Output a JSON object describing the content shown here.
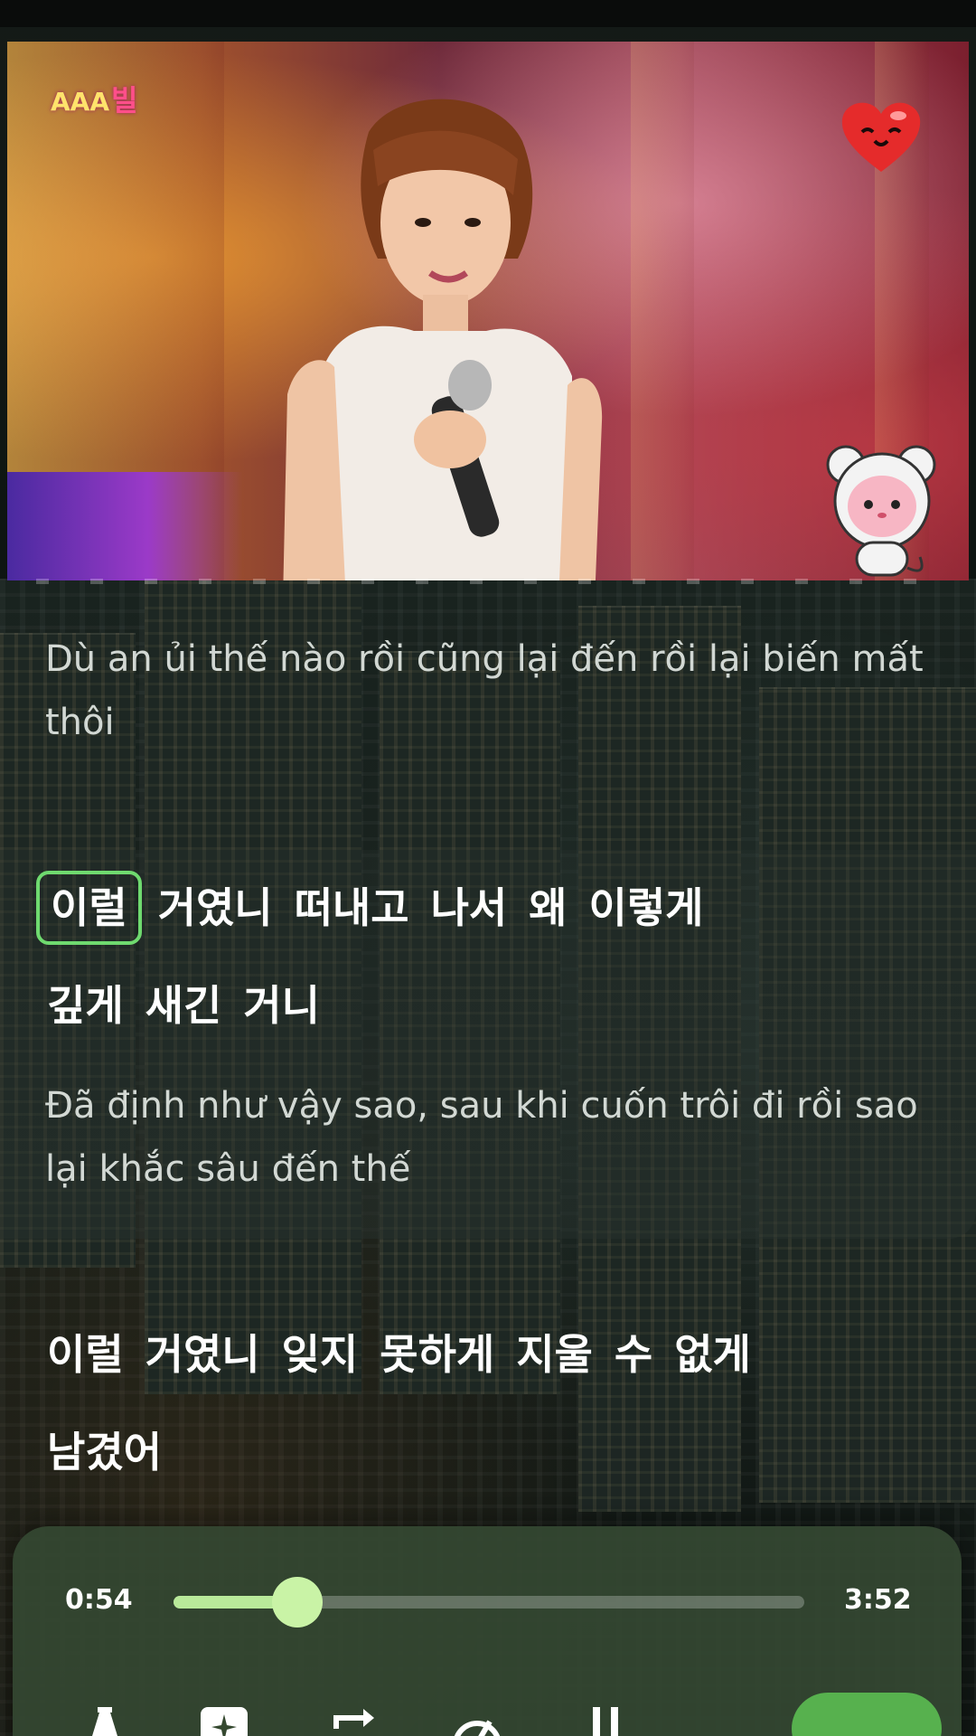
{
  "video": {
    "logo_text": "AAA",
    "logo_korean": "빌"
  },
  "lyrics": {
    "line1_translation": "Dù an ủi thế nào rồi cũng lại đến rồi lại biến mất thôi",
    "line2_korean_words": [
      "이럴",
      "거였니",
      "떠내고",
      "나서",
      "왜",
      "이렇게",
      "깊게",
      "새긴",
      "거니"
    ],
    "line2_active_word": "이럴",
    "line2_translation": "Đã định như vậy sao, sau khi cuốn trôi đi rồi sao lại khắc sâu đến thế",
    "line3_korean_words": [
      "이럴",
      "거였니",
      "잊지",
      "못하게",
      "지울",
      "수",
      "없게",
      "남겼어"
    ]
  },
  "player": {
    "current_time": "0:54",
    "total_time": "3:52",
    "progress": 0.196
  },
  "colors": {
    "accent_green": "#6fda6f",
    "progress_fill": "#b9ea9a",
    "player_bg": "#34482f",
    "play_button": "#57b14e"
  },
  "icons": [
    "heart-icon",
    "mascot-icon",
    "pin-icon",
    "sparkle-icon",
    "repeat-icon",
    "speed-icon",
    "pause-icon"
  ]
}
